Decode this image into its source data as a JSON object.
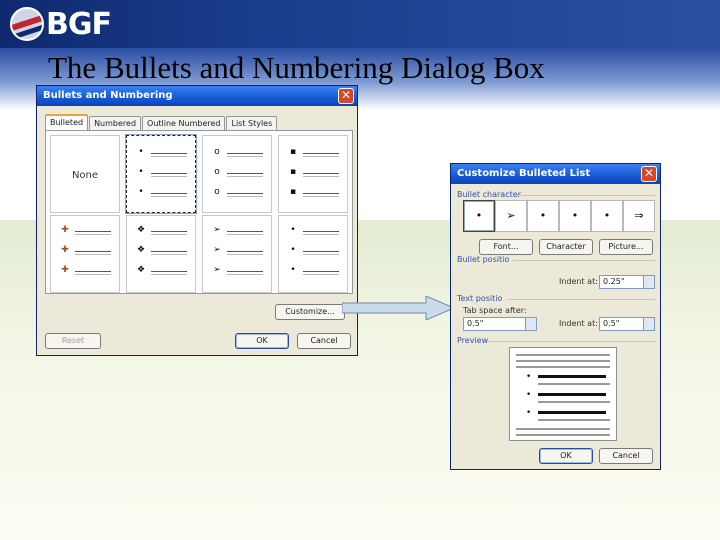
{
  "slide": {
    "logo_text": "BGF",
    "title": "The Bullets and Numbering Dialog Box"
  },
  "dialog1": {
    "title": "Bullets and Numbering",
    "tabs": [
      {
        "label": "Bulleted",
        "active": true
      },
      {
        "label": "Numbered",
        "active": false
      },
      {
        "label": "Outline Numbered",
        "active": false
      },
      {
        "label": "List Styles",
        "active": false
      }
    ],
    "none_label": "None",
    "tiles": [
      {
        "glyph": "•"
      },
      {
        "glyph": "o"
      },
      {
        "glyph": "▪"
      },
      {
        "glyph": "✚"
      },
      {
        "glyph": "❖"
      },
      {
        "glyph": "➢"
      },
      {
        "glyph": "•"
      }
    ],
    "customize_label": "Customize...",
    "reset_label": "Reset",
    "ok_label": "OK",
    "cancel_label": "Cancel"
  },
  "dialog2": {
    "title": "Customize Bulleted List",
    "bullet_character_label": "Bullet character",
    "bullet_characters": [
      "•",
      "➢",
      "•",
      "•",
      "•",
      "⇒"
    ],
    "font_button": "Font...",
    "character_button": "Character",
    "picture_button": "Picture...",
    "bullet_position_label": "Bullet positio",
    "indent_at_label_1": "Indent at:",
    "indent_at_value_1": "0.25\"",
    "text_position_label": "Text positio",
    "tab_space_after_label": "Tab space after:",
    "tab_space_after_value": "0.5\"",
    "indent_at_label_2": "Indent at:",
    "indent_at_value_2": "0.5\"",
    "preview_label": "Preview",
    "ok_label": "OK",
    "cancel_label": "Cancel"
  },
  "colors": {
    "header_navy": "#0e2a6e",
    "titlebar_blue": "#1c5fd8",
    "dialog_face": "#ece9d8",
    "group_label_blue": "#3350a8"
  }
}
